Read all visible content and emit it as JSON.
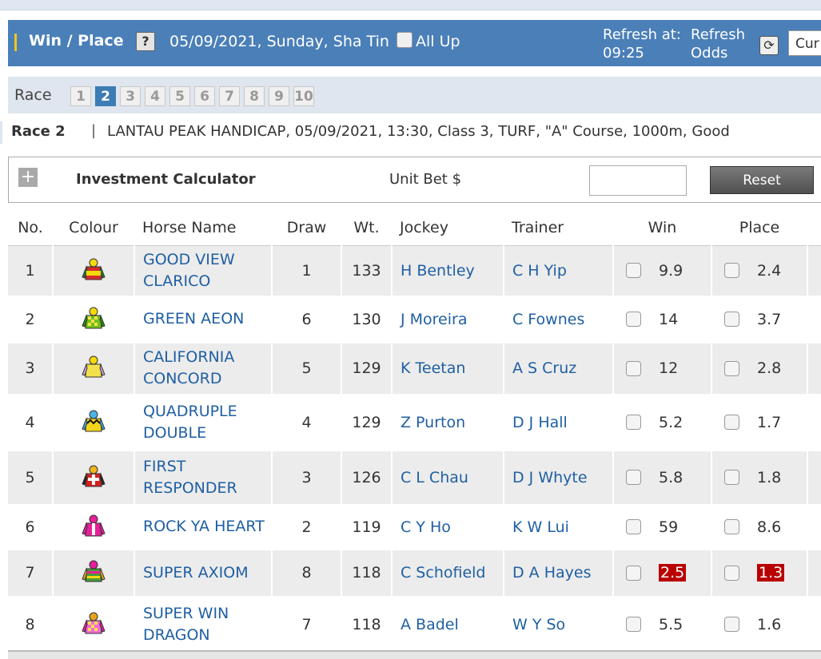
{
  "header": {
    "title": "Win / Place",
    "help_icon": "?",
    "meeting": "05/09/2021, Sunday, Sha Tin",
    "all_up_label": "All Up",
    "refresh_at_label": "Refresh at:",
    "refresh_time": "09:25",
    "refresh_odds_line1": "Refresh",
    "refresh_odds_line2": "Odds",
    "odds_select_value": "Cur"
  },
  "race_selector": {
    "label": "Race",
    "races": [
      "1",
      "2",
      "3",
      "4",
      "5",
      "6",
      "7",
      "8",
      "9",
      "10"
    ],
    "active": "2"
  },
  "race_info": {
    "race_no": "Race 2",
    "separator": "|",
    "description": "LANTAU PEAK HANDICAP, 05/09/2021, 13:30, Class 3, TURF, \"A\" Course, 1000m, Good"
  },
  "calculator": {
    "title": "Investment Calculator",
    "unit_bet_label": "Unit Bet $",
    "unit_bet_value": "",
    "reset_label": "Reset"
  },
  "table": {
    "headers": {
      "no": "No.",
      "colour": "Colour",
      "horse": "Horse Name",
      "draw": "Draw",
      "wt": "Wt.",
      "jockey": "Jockey",
      "trainer": "Trainer",
      "win": "Win",
      "place": "Place"
    },
    "rows": [
      {
        "no": "1",
        "horse_l1": "GOOD VIEW",
        "horse_l2": "CLARICO",
        "draw": "1",
        "wt": "133",
        "jockey": "H Bentley",
        "trainer": "C H Yip",
        "win": "9.9",
        "place": "2.4",
        "win_hot": false,
        "place_hot": false,
        "silk": {
          "cap": "#f5d90a",
          "body": "#d52b2b",
          "sleeve": "#1f7a34",
          "pattern": "band"
        }
      },
      {
        "no": "2",
        "horse_l1": "GREEN AEON",
        "horse_l2": "",
        "draw": "6",
        "wt": "130",
        "jockey": "J Moreira",
        "trainer": "C Fownes",
        "win": "14",
        "place": "3.7",
        "win_hot": false,
        "place_hot": false,
        "silk": {
          "cap": "#f5d90a",
          "body": "#6ec21c",
          "sleeve": "#2d8a12",
          "pattern": "check"
        }
      },
      {
        "no": "3",
        "horse_l1": "CALIFORNIA",
        "horse_l2": "CONCORD",
        "draw": "5",
        "wt": "129",
        "jockey": "K Teetan",
        "trainer": "A S Cruz",
        "win": "12",
        "place": "2.8",
        "win_hot": false,
        "place_hot": false,
        "silk": {
          "cap": "#f5d90a",
          "body": "#f2e14a",
          "sleeve": "#c9a0de",
          "pattern": "plain"
        }
      },
      {
        "no": "4",
        "horse_l1": "QUADRUPLE",
        "horse_l2": "DOUBLE",
        "draw": "4",
        "wt": "129",
        "jockey": "Z Purton",
        "trainer": "D J Hall",
        "win": "5.2",
        "place": "1.7",
        "win_hot": false,
        "place_hot": false,
        "silk": {
          "cap": "#4ab3e8",
          "body": "#f2d41c",
          "sleeve": "#3aa3dc",
          "pattern": "zigzag"
        }
      },
      {
        "no": "5",
        "horse_l1": "FIRST",
        "horse_l2": "RESPONDER",
        "draw": "3",
        "wt": "126",
        "jockey": "C L Chau",
        "trainer": "D J Whyte",
        "win": "5.8",
        "place": "1.8",
        "win_hot": false,
        "place_hot": false,
        "silk": {
          "cap": "#f2b41c",
          "body": "#d42020",
          "sleeve": "#222222",
          "pattern": "cross"
        }
      },
      {
        "no": "6",
        "horse_l1": "ROCK YA HEART",
        "horse_l2": "",
        "draw": "2",
        "wt": "119",
        "jockey": "C Y Ho",
        "trainer": "K W Lui",
        "win": "59",
        "place": "8.6",
        "win_hot": false,
        "place_hot": false,
        "silk": {
          "cap": "#e81f9a",
          "body": "#e81f9a",
          "sleeve": "#e81f9a",
          "pattern": "stripe"
        }
      },
      {
        "no": "7",
        "horse_l1": "SUPER AXIOM",
        "horse_l2": "",
        "draw": "8",
        "wt": "118",
        "jockey": "C Schofield",
        "trainer": "D A Hayes",
        "win": "2.5",
        "place": "1.3",
        "win_hot": true,
        "place_hot": true,
        "silk": {
          "cap": "#e81f9a",
          "body": "#4a9a3a",
          "sleeve": "#e8a01f",
          "pattern": "multi"
        }
      },
      {
        "no": "8",
        "horse_l1": "SUPER WIN",
        "horse_l2": "DRAGON",
        "draw": "7",
        "wt": "118",
        "jockey": "A Badel",
        "trainer": "W Y So",
        "win": "5.5",
        "place": "1.6",
        "win_hot": false,
        "place_hot": false,
        "silk": {
          "cap": "#e8a01f",
          "body": "#f06ad8",
          "sleeve": "#e81f9a",
          "pattern": "check"
        }
      }
    ]
  }
}
